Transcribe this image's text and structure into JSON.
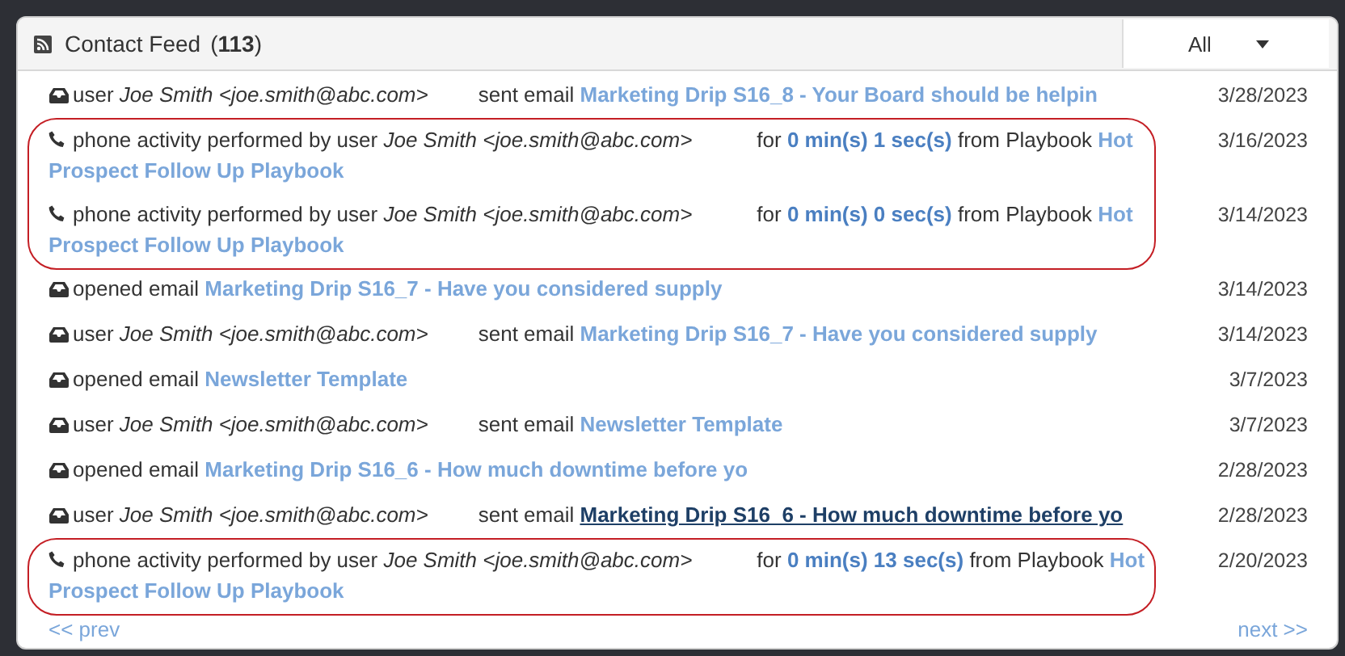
{
  "panel": {
    "title": "Contact Feed",
    "count": "(**113**)",
    "filter": {
      "value": "All"
    }
  },
  "items": [
    {
      "kind": "sent",
      "prefix": "user",
      "user": "Joe Smith <joe.smith@abc.com>",
      "action": "sent email",
      "link": "Marketing Drip S16_8 - Your Board should be helpin",
      "hovered": false,
      "date": "3/28/2023",
      "circled": false
    },
    {
      "kind": "phone",
      "prefix": "phone activity performed by user",
      "user": "Joe Smith <joe.smith@abc.com>",
      "for_label": "for",
      "duration": "0 min(s) 1 sec(s)",
      "source": "from Playbook",
      "link_lines": [
        "Hot",
        "Prospect Follow Up Playbook"
      ],
      "hovered": false,
      "date": "3/16/2023",
      "circled": true
    },
    {
      "kind": "phone",
      "prefix": "phone activity performed by user",
      "user": "Joe Smith <joe.smith@abc.com>",
      "for_label": "for",
      "duration": "0 min(s) 0 sec(s)",
      "source": "from Playbook",
      "link_lines": [
        "Hot",
        "Prospect Follow Up Playbook"
      ],
      "hovered": false,
      "date": "3/14/2023",
      "circled": true
    },
    {
      "kind": "opened",
      "action": "opened email",
      "link": "Marketing Drip S16_7 - Have you considered supply",
      "hovered": false,
      "date": "3/14/2023",
      "circled": false
    },
    {
      "kind": "sent",
      "prefix": "user",
      "user": "Joe Smith <joe.smith@abc.com>",
      "action": "sent email",
      "link": "Marketing Drip S16_7 - Have you considered supply",
      "hovered": false,
      "date": "3/14/2023",
      "circled": false
    },
    {
      "kind": "opened",
      "action": "opened email",
      "link": "Newsletter Template",
      "hovered": false,
      "date": "3/7/2023",
      "circled": false
    },
    {
      "kind": "sent",
      "prefix": "user",
      "user": "Joe Smith <joe.smith@abc.com>",
      "action": "sent email",
      "link": "Newsletter Template",
      "hovered": false,
      "date": "3/7/2023",
      "circled": false
    },
    {
      "kind": "opened",
      "action": "opened email",
      "link": "Marketing Drip S16_6 - How much downtime before yo",
      "hovered": false,
      "date": "2/28/2023",
      "circled": false
    },
    {
      "kind": "sent",
      "prefix": "user",
      "user": "Joe Smith <joe.smith@abc.com>",
      "action": "sent email",
      "link": "Marketing Drip S16_6 - How much downtime before yo",
      "hovered": true,
      "date": "2/28/2023",
      "circled": false
    },
    {
      "kind": "phone",
      "prefix": "phone activity performed by user",
      "user": "Joe Smith <joe.smith@abc.com>",
      "for_label": "for",
      "duration": "0 min(s) 13 sec(s)",
      "source": "from Playbook",
      "link_lines": [
        "Hot",
        "Prospect Follow Up Playbook"
      ],
      "hovered": false,
      "date": "2/20/2023",
      "circled": true
    }
  ],
  "pager": {
    "prev": "<< prev",
    "next": "next >>"
  }
}
